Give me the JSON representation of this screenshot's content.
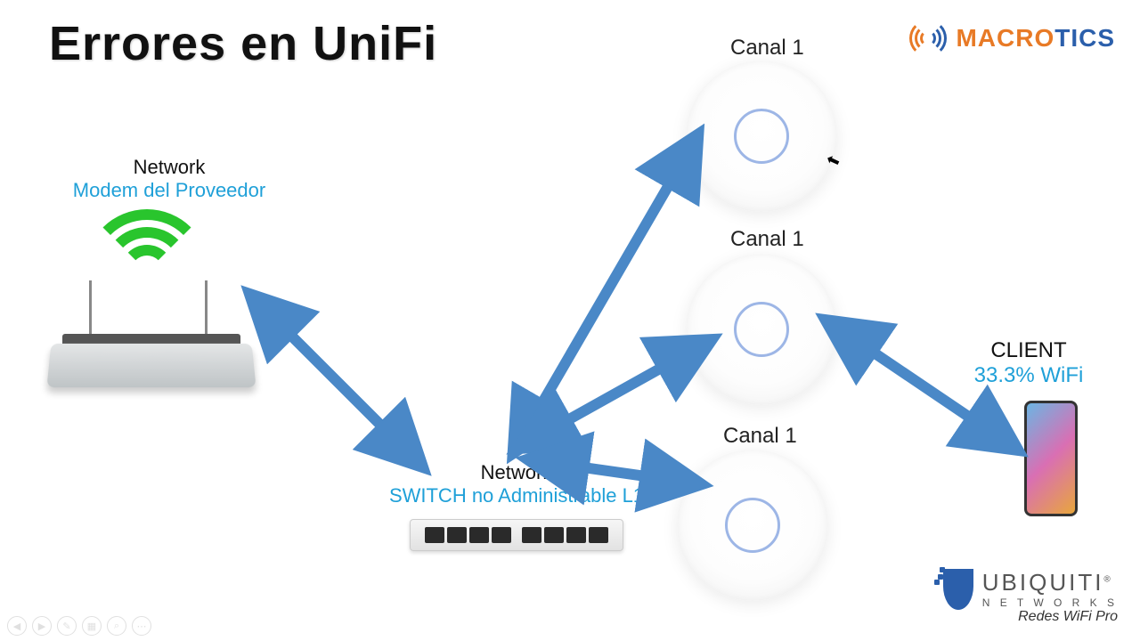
{
  "title": "Errores en UniFi",
  "modem": {
    "label1": "Network",
    "label2": "Modem del Proveedor"
  },
  "switch": {
    "label1": "Network",
    "label2": "SWITCH no Administrable L1"
  },
  "access_points": [
    {
      "label": "Canal 1"
    },
    {
      "label": "Canal 1"
    },
    {
      "label": "Canal 1"
    }
  ],
  "client": {
    "label1": "CLIENT",
    "label2": "33.3% WiFi"
  },
  "brand_top": {
    "name": "MACROTICS"
  },
  "brand_bottom": {
    "name": "UBIQUITI",
    "sub": "N E T W O R K S",
    "tag": "Redes WiFi Pro"
  },
  "colors": {
    "arrow": "#4a88c7",
    "blue_text": "#1fa0d8"
  }
}
